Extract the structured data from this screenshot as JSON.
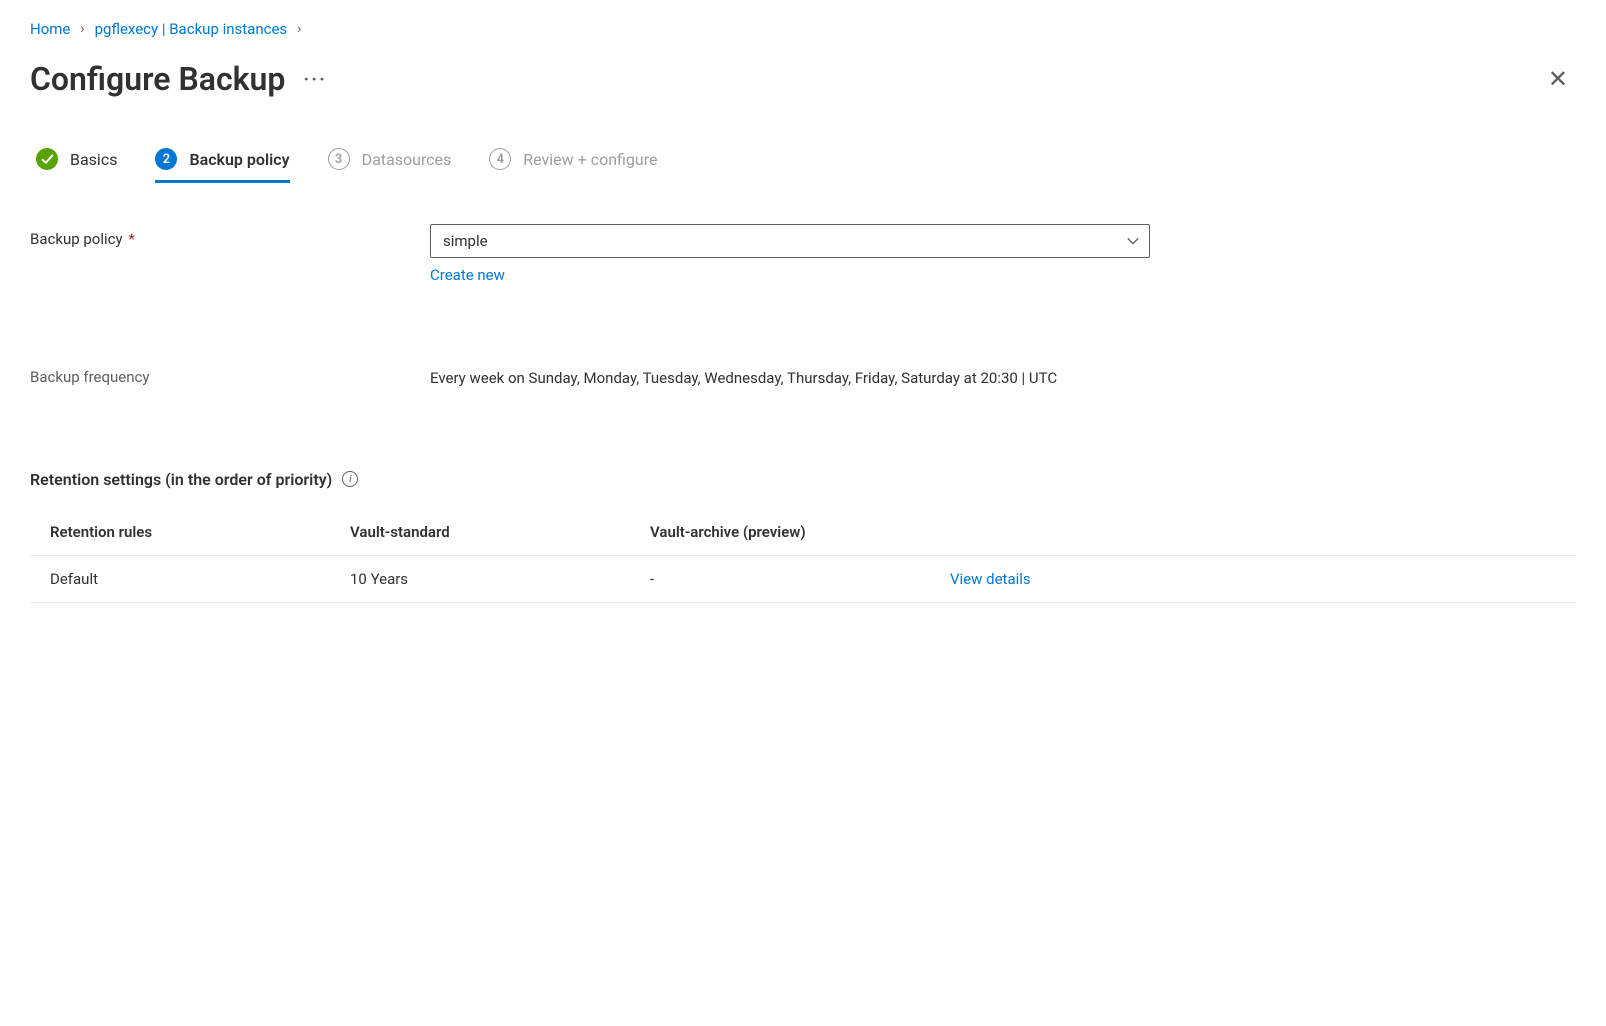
{
  "breadcrumb": {
    "home": "Home",
    "instance": "pgflexecy | Backup instances"
  },
  "page": {
    "title": "Configure Backup"
  },
  "steps": {
    "s1": {
      "label": "Basics"
    },
    "s2": {
      "label": "Backup policy",
      "num": "2"
    },
    "s3": {
      "label": "Datasources",
      "num": "3"
    },
    "s4": {
      "label": "Review + configure",
      "num": "4"
    }
  },
  "form": {
    "policy_label": "Backup policy",
    "policy_value": "simple",
    "create_new": "Create new",
    "freq_label": "Backup frequency",
    "freq_value": "Every week on Sunday, Monday, Tuesday, Wednesday, Thursday, Friday, Saturday at 20:30 | UTC"
  },
  "retention": {
    "title": "Retention settings (in the order of priority)",
    "columns": {
      "rules": "Retention rules",
      "standard": "Vault-standard",
      "archive": "Vault-archive (preview)"
    },
    "rows": [
      {
        "name": "Default",
        "standard": "10 Years",
        "archive": "-",
        "action": "View details"
      }
    ]
  }
}
